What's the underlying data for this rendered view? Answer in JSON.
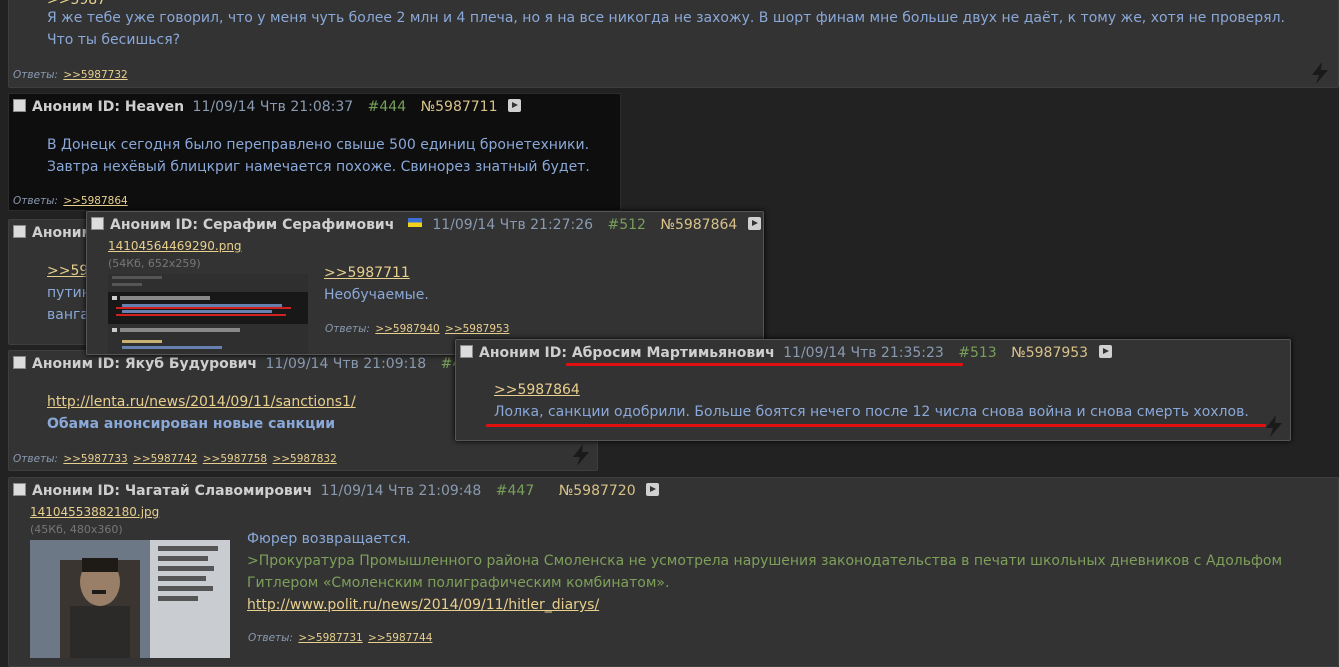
{
  "post_top": {
    "ref_cut": ">>5987",
    "text1": "Я же тебе уже говорил, что у меня чуть более 2 млн и 4 плеча, но я на все никогда не захожу. В шорт финам мне больше двух не даёт, к тому же, хотя не проверял.",
    "text2": "Что ты бесишься?",
    "replies_label": "Ответы:",
    "replies": [
      ">>5987732"
    ]
  },
  "post_heaven": {
    "anon": "Аноним",
    "id_name": "ID: Heaven",
    "date": "11/09/14 Чтв 21:08:37",
    "num": "#444",
    "no": "№5987711",
    "text1": "В Донецк сегодня было переправлено свыше 500 единиц бронетехники.",
    "text2": "Завтра нехёвый блицкриг намечается похоже. Свинорез знатный будет.",
    "replies_label": "Ответы:",
    "replies": [
      ">>5987864"
    ]
  },
  "post_hidden": {
    "anon": "Аноним",
    "ref": ">>598",
    "line1": "путин",
    "line2": "ванга"
  },
  "post_yakub": {
    "anon": "Аноним",
    "id_name": "ID: Якуб Будурович",
    "date": "11/09/14 Чтв 21:09:18",
    "num_cut": "#4",
    "link": "http://lenta.ru/news/2014/09/11/sanctions1/",
    "bold_text": "Обама анонсирован новые санкции",
    "replies_label": "Ответы:",
    "replies": [
      ">>5987733",
      ">>5987742",
      ">>5987758",
      ">>5987832"
    ]
  },
  "popup_serafim": {
    "anon": "Аноним",
    "id_name": "ID: Серафим Серафимович",
    "date": "11/09/14 Чтв 21:27:26",
    "num": "#512",
    "no": "№5987864",
    "file_name": "14104564469290.png",
    "file_info": "(54Кб, 652x259)",
    "ref": ">>5987711",
    "text": "Необучаемые.",
    "replies_label": "Ответы:",
    "replies": [
      ">>5987940",
      ">>5987953"
    ]
  },
  "popup_abrosim": {
    "anon": "Аноним",
    "id_name": "ID: Абросим Мартимьянович",
    "date": "11/09/14 Чтв 21:35:23",
    "num": "#513",
    "no": "№5987953",
    "ref": ">>5987864",
    "text": "Лолка, санкции одобрили. Больше боятся нечего после 12 числа снова война и снова смерть хохлов."
  },
  "post_chagatai": {
    "anon": "Аноним",
    "id_name": "ID: Чагатай Славомирович",
    "date": "11/09/14 Чтв 21:09:48",
    "num": "#447",
    "no": "№5987720",
    "file_name": "14104553882180.jpg",
    "file_info": "(45Кб, 480x360)",
    "text1": "Фюрер возвращается.",
    "quote1": ">Прокуратура Промышленного района Смоленска не усмотрела нарушения законодательства в печати школьных дневников с Адольфом",
    "quote2": "Гитлером «Смоленским полиграфическим комбинатом».",
    "link": "http://www.polit.ru/news/2014/09/11/hitler_diarys/",
    "replies_label": "Ответы:",
    "replies": [
      ">>5987731",
      ">>5987744"
    ]
  },
  "colors": {
    "background": "#222222",
    "post_bg": "#333333",
    "message_text": "#8aa8d8",
    "link": "#e8cf8e",
    "quote": "#7ea05a",
    "post_number": "#78a05a",
    "highlight_underline": "#e01010"
  }
}
